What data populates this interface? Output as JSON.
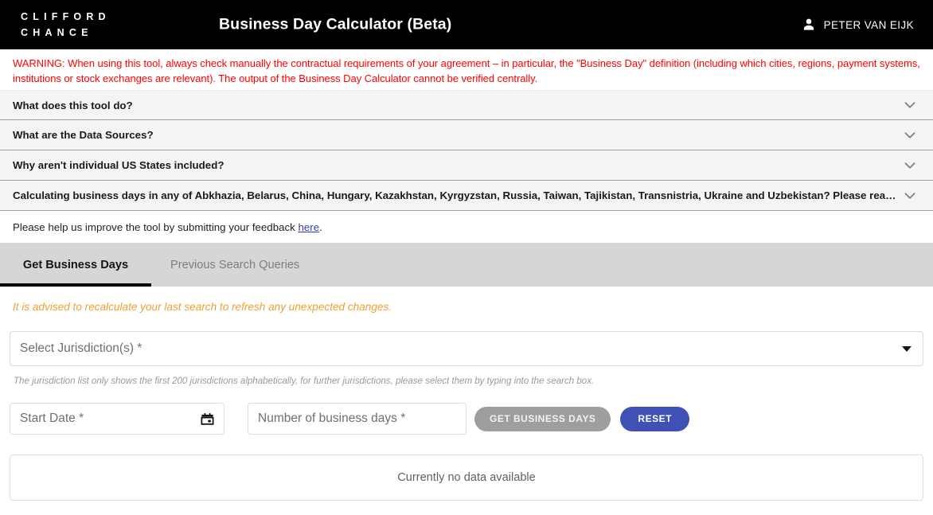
{
  "header": {
    "brand_line1": "CLIFFORD",
    "brand_line2": "CHANCE",
    "title": "Business Day Calculator (Beta)",
    "user_name": "PETER VAN EIJK",
    "user_icon": "person-icon",
    "background_color": "#000000"
  },
  "warning": {
    "text": "WARNING: When using this tool, always check manually the contractual requirements of your agreement – in particular, the \"Business Day\" definition (including which cities, regions, payment systems, institutions or stock exchanges are relevant). The output of the Business Day Calculator cannot be verified centrally.",
    "color": "#ff0000"
  },
  "accordions": [
    {
      "label": "What does this tool do?",
      "icon": "chevron-down-icon",
      "expanded": false
    },
    {
      "label": "What are the Data Sources?",
      "icon": "chevron-down-icon",
      "expanded": false
    },
    {
      "label": "Why aren't individual US States included?",
      "icon": "chevron-down-icon",
      "expanded": false
    },
    {
      "label": "Calculating business days in any of Abkhazia, Belarus, China, Hungary, Kazakhstan, Kyrgyzstan, Russia, Taiwan, Tajikistan, Transnistria, Ukraine and Uzbekistan? Please read this.",
      "icon": "chevron-down-icon",
      "expanded": false
    }
  ],
  "feedback": {
    "text_before": "Please help us improve the tool by submitting your feedback ",
    "link_label": "here",
    "text_after": "."
  },
  "tabs": [
    {
      "label": "Get Business Days",
      "active": true
    },
    {
      "label": "Previous Search Queries",
      "active": false
    }
  ],
  "advice": {
    "text": "It is advised to recalculate your last search to refresh any unexpected changes.",
    "color": "#f0a030"
  },
  "form": {
    "jurisdiction_placeholder": "Select Jurisdiction(s) *",
    "jurisdiction_caret_icon": "caret-down-icon",
    "jurisdiction_hint": "The jurisdiction list only shows the first 200 jurisdictions alphabetically, for further jurisdictions, please select them by typing into the search box.",
    "start_date_placeholder": "Start Date *",
    "start_date_icon": "calendar-icon",
    "start_date_value": "",
    "business_days_placeholder": "Number of business days *",
    "business_days_value": "",
    "get_business_days_label": "GET BUSINESS DAYS",
    "get_business_days_disabled": true,
    "reset_label": "RESET",
    "reset_color": "#3f51b5"
  },
  "results": {
    "empty_message": "Currently no data available"
  }
}
